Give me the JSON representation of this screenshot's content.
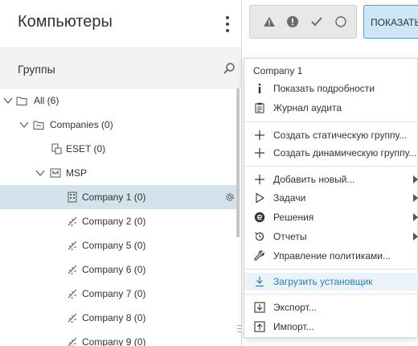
{
  "header": {
    "title": "Компьютеры"
  },
  "groups": {
    "title": "Группы"
  },
  "tree": {
    "items": [
      {
        "label": "All (6)"
      },
      {
        "label": "Companies (0)"
      },
      {
        "label": "ESET (0)"
      },
      {
        "label": "MSP"
      },
      {
        "label": "Company 1 (0)"
      },
      {
        "label": "Company 2 (0)"
      },
      {
        "label": "Company 5 (0)"
      },
      {
        "label": "Company 6 (0)"
      },
      {
        "label": "Company 7 (0)"
      },
      {
        "label": "Company 8 (0)"
      },
      {
        "label": "Company 9 (0)"
      }
    ]
  },
  "toolbar": {
    "show_label": "ПОКАЗАТЬ"
  },
  "context_menu": {
    "title": "Company 1",
    "items": [
      {
        "label": "Показать подробности",
        "icon": "info-icon"
      },
      {
        "label": "Журнал аудита",
        "icon": "audit-log-icon"
      },
      {
        "label": "Создать статическую группу...",
        "icon": "plus-icon"
      },
      {
        "label": "Создать динамическую группу...",
        "icon": "plus-icon"
      },
      {
        "label": "Добавить новый...",
        "icon": "plus-icon"
      },
      {
        "label": "Задачи",
        "icon": "play-icon"
      },
      {
        "label": "Решения",
        "icon": "solutions-icon"
      },
      {
        "label": "Отчеты",
        "icon": "reports-icon"
      },
      {
        "label": "Управление политиками...",
        "icon": "wrench-icon"
      },
      {
        "label": "Загрузить установщик",
        "icon": "download-icon"
      },
      {
        "label": "Экспорт...",
        "icon": "export-icon"
      },
      {
        "label": "Импорт...",
        "icon": "import-icon"
      }
    ]
  },
  "colors": {
    "selected_row": "#d2e3ec",
    "accent_blue": "#2b7db3",
    "show_button_bg": "#cde7f4"
  }
}
